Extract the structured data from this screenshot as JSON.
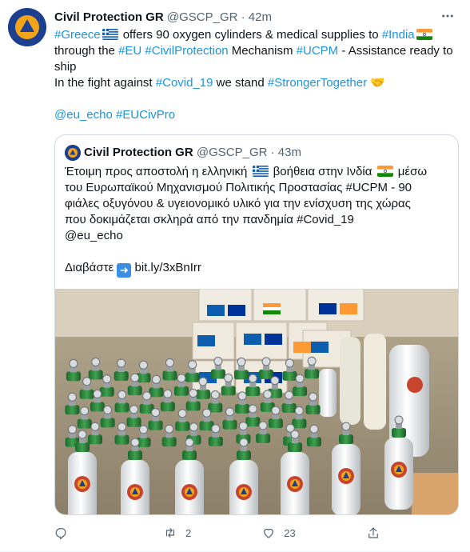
{
  "author": {
    "name": "Civil Protection GR",
    "handle": "@GSCP_GR",
    "time": "42m",
    "avatar_text": "ΠΟΛΙΤΙΚΗ ΠΡΟΣΤΑΣΙΑ ΕΛΛΑΔΑ"
  },
  "tweet": {
    "line1": [
      {
        "t": "#Greece",
        "link": true
      },
      {
        "flag": "gr"
      },
      {
        "t": " offers 90 oxygen cylinders & medical supplies to ",
        "link": false
      },
      {
        "t": "#India",
        "link": true
      },
      {
        "flag": "in"
      }
    ],
    "line2": [
      {
        "t": "through the ",
        "link": false
      },
      {
        "t": "#EU",
        "link": true
      },
      {
        "t": " ",
        "link": false
      },
      {
        "t": "#CivilProtection",
        "link": true
      },
      {
        "t": " Mechanism ",
        "link": false
      },
      {
        "t": "#UCPM",
        "link": true
      },
      {
        "t": " - Assistance ready to ship",
        "link": false
      }
    ],
    "line3": [
      {
        "t": "In the fight against ",
        "link": false
      },
      {
        "t": "#Covid_19",
        "link": true
      },
      {
        "t": " we stand ",
        "link": false
      },
      {
        "t": "#StrongerTogether",
        "link": true
      },
      {
        "t": " 🤝",
        "link": false
      }
    ],
    "line4": [
      {
        "t": "@eu_echo",
        "link": true
      },
      {
        "t": " ",
        "link": false
      },
      {
        "t": "#EUCivPro",
        "link": true
      }
    ]
  },
  "quoted": {
    "name": "Civil Protection GR",
    "handle": "@GSCP_GR",
    "time": "43m",
    "text_l1": "Έτοιμη προς αποστολή η ελληνική",
    "text_l1b": "βοήθεια στην Ινδία",
    "text_l1c": "μέσω",
    "text_l2": "του Ευρωπαϊκού Μηχανισμού Πολιτικής Προστασίας #UCPM - 90",
    "text_l3": "φιάλες οξυγόνου & υγειονομικό υλικό για την ενίσχυση της χώρας",
    "text_l4": "που δοκιμάζεται σκληρά από την πανδημία #Covid_19",
    "text_l5": "@eu_echo",
    "read_label": "Διαβάστε",
    "read_link": "bit.ly/3xBnIrr"
  },
  "actions": {
    "reply_count": "",
    "retweet_count": "2",
    "like_count": "23"
  },
  "colors": {
    "link": "#1b95e0",
    "muted": "#536471",
    "border": "#cfd9de"
  },
  "icons": [
    "more-icon",
    "reply-icon",
    "retweet-icon",
    "like-icon",
    "share-icon",
    "arrow-right-icon"
  ]
}
